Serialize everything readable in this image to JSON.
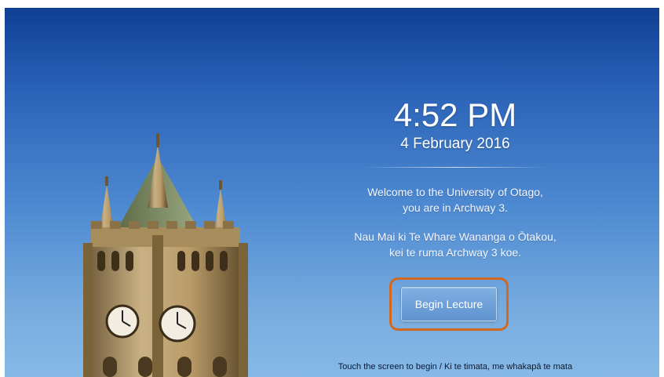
{
  "clock": {
    "time": "4:52 PM",
    "date": "4 February 2016"
  },
  "welcome": {
    "english_line1": "Welcome to the University of Otago,",
    "english_line2": "you are in Archway 3.",
    "maori_line1": "Nau Mai ki Te Whare Wananga o Ōtakou,",
    "maori_line2": "kei te ruma Archway 3 koe."
  },
  "actions": {
    "begin_label": "Begin Lecture"
  },
  "footer": {
    "hint": "Touch the screen to begin / Ki te timata, me whakapā te mata"
  },
  "colors": {
    "sky_top": "#0f3f93",
    "sky_bottom": "#86b9e6",
    "highlight": "#d2691e",
    "button": "#6a9fd8"
  },
  "icons": {
    "background": "clock-tower-photo"
  }
}
